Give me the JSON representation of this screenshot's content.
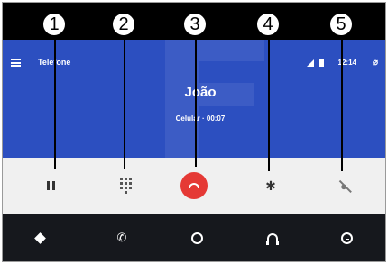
{
  "header": {
    "title": "Telefone"
  },
  "status": {
    "time": "12:14",
    "signal_icon": "signal-icon",
    "battery_icon": "battery-icon",
    "mic_mute_icon": "mic-off-icon"
  },
  "call": {
    "caller_name": "João",
    "caller_info": "Celular · 00:07"
  },
  "controls": [
    {
      "icon": "pause-icon"
    },
    {
      "icon": "dialpad-icon"
    },
    {
      "icon": "end-call-icon",
      "color": "#e53935"
    },
    {
      "icon": "bluetooth-icon"
    },
    {
      "icon": "mic-off-icon"
    }
  ],
  "navbar": [
    {
      "icon": "directions-icon"
    },
    {
      "icon": "phone-icon"
    },
    {
      "icon": "home-icon"
    },
    {
      "icon": "headphones-icon"
    },
    {
      "icon": "recents-icon"
    }
  ],
  "callouts": [
    "1",
    "2",
    "3",
    "4",
    "5"
  ],
  "colors": {
    "call_background": "#2c4fc0",
    "controls_background": "#f0f0f0",
    "navbar_background": "#16181d",
    "end_call": "#e53935"
  }
}
